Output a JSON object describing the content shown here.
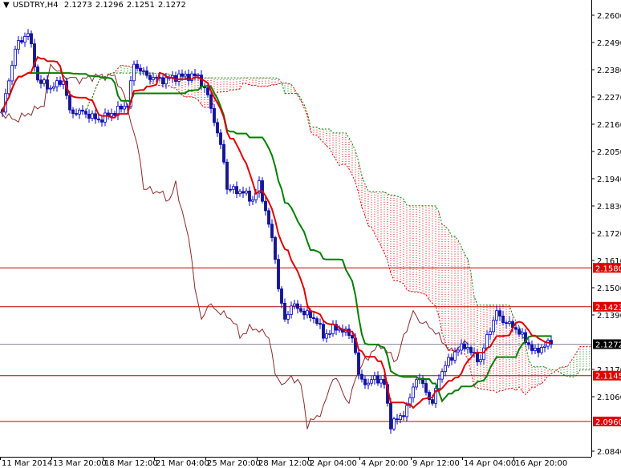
{
  "header": {
    "symbol": "USDTRY,H4",
    "open": "2.1273",
    "high": "2.1296",
    "low": "2.1251",
    "close": "2.1272",
    "menu_icon": "triangle-down-icon"
  },
  "colors": {
    "bull": "#0000c8",
    "bear": "#1a1a6e",
    "tenkan": "#e00000",
    "kijun": "#008000",
    "chikou": "#8b2a2a",
    "cloud_bear": "#e00000",
    "cloud_bull": "#008000",
    "level": "#c00000",
    "label_bg": "#e00000",
    "current": "#000000"
  },
  "chart_data": {
    "type": "candlestick",
    "title": "USDTRY,H4",
    "ylim": [
      2.084,
      2.26
    ],
    "y_ticks": [
      "2.2600",
      "2.2490",
      "2.2380",
      "2.2270",
      "2.2160",
      "2.2050",
      "2.1940",
      "2.1830",
      "2.1720",
      "2.1610",
      "2.1500",
      "2.1390",
      "2.1170",
      "2.1060",
      "2.0840"
    ],
    "x_ticks": [
      {
        "bar": 0,
        "label": "11 Mar 2014"
      },
      {
        "bar": 16,
        "label": "13 Mar 20:00"
      },
      {
        "bar": 32,
        "label": "18 Mar 12:00"
      },
      {
        "bar": 48,
        "label": "21 Mar 04:00"
      },
      {
        "bar": 64,
        "label": "25 Mar 20:00"
      },
      {
        "bar": 80,
        "label": "28 Mar 12:00"
      },
      {
        "bar": 96,
        "label": "2 Apr 04:00"
      },
      {
        "bar": 112,
        "label": "4 Apr 20:00"
      },
      {
        "bar": 128,
        "label": "9 Apr 12:00"
      },
      {
        "bar": 144,
        "label": "14 Apr 04:00"
      },
      {
        "bar": 160,
        "label": "16 Apr 20:00"
      }
    ],
    "levels": [
      {
        "price": 2.158,
        "label": "2.1580"
      },
      {
        "price": 2.1423,
        "label": "2.1423"
      },
      {
        "price": 2.1145,
        "label": "2.1145"
      },
      {
        "price": 2.096,
        "label": "2.0960"
      }
    ],
    "current_price": {
      "price": 2.1272,
      "label": "2.1272"
    },
    "ichimoku": {
      "tenkan": 9,
      "kijun": 26,
      "senkou": 52
    },
    "close_keypoints": [
      [
        0,
        2.2209
      ],
      [
        4,
        2.2467
      ],
      [
        8,
        2.2532
      ],
      [
        11,
        2.2338
      ],
      [
        15,
        2.2306
      ],
      [
        19,
        2.2338
      ],
      [
        21,
        2.2209
      ],
      [
        25,
        2.2209
      ],
      [
        30,
        2.2176
      ],
      [
        35,
        2.2209
      ],
      [
        39,
        2.2241
      ],
      [
        41,
        2.2403
      ],
      [
        45,
        2.2354
      ],
      [
        50,
        2.2338
      ],
      [
        55,
        2.2354
      ],
      [
        61,
        2.2354
      ],
      [
        64,
        2.2273
      ],
      [
        66,
        2.2176
      ],
      [
        69,
        2.2014
      ],
      [
        70,
        2.1901
      ],
      [
        75,
        2.1885
      ],
      [
        78,
        2.1853
      ],
      [
        80,
        2.1917
      ],
      [
        83,
        2.1756
      ],
      [
        85,
        2.1626
      ],
      [
        86,
        2.1497
      ],
      [
        88,
        2.1367
      ],
      [
        90,
        2.1432
      ],
      [
        94,
        2.14
      ],
      [
        98,
        2.1367
      ],
      [
        100,
        2.1303
      ],
      [
        103,
        2.1335
      ],
      [
        105,
        2.1335
      ],
      [
        109,
        2.1303
      ],
      [
        110,
        2.1238
      ],
      [
        111,
        2.1141
      ],
      [
        114,
        2.1109
      ],
      [
        116,
        2.1141
      ],
      [
        119,
        2.1109
      ],
      [
        121,
        2.0947
      ],
      [
        124,
        2.0979
      ],
      [
        126,
        2.1012
      ],
      [
        129,
        2.1141
      ],
      [
        131,
        2.1109
      ],
      [
        134,
        2.1028
      ],
      [
        136,
        2.1141
      ],
      [
        139,
        2.1206
      ],
      [
        141,
        2.1238
      ],
      [
        144,
        2.127
      ],
      [
        146,
        2.1238
      ],
      [
        149,
        2.1206
      ],
      [
        151,
        2.1303
      ],
      [
        154,
        2.14
      ],
      [
        156,
        2.1367
      ],
      [
        160,
        2.1335
      ],
      [
        164,
        2.127
      ],
      [
        166,
        2.1238
      ],
      [
        169,
        2.127
      ],
      [
        171,
        2.1272
      ]
    ]
  }
}
